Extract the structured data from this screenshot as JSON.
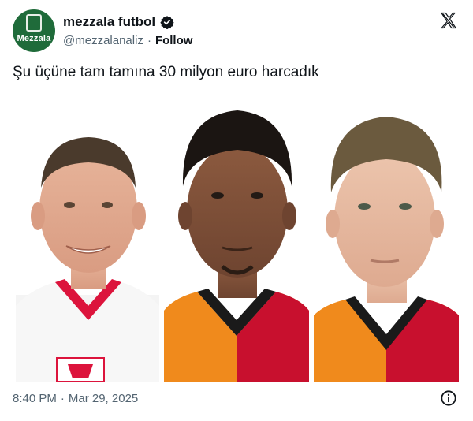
{
  "account": {
    "display_name": "mezzala futbol",
    "handle": "@mezzalanaliz",
    "separator": "·",
    "follow_label": "Follow",
    "avatar_text": "Mezzala",
    "verified": true,
    "avatar_color": "#1f6b3a"
  },
  "tweet": {
    "text": "Şu üçüne tam tamına 30 milyon euro harcadık"
  },
  "media": {
    "description_icons": [
      "player-1",
      "player-2",
      "player-3"
    ]
  },
  "footer": {
    "time": "8:40 PM",
    "dot": "·",
    "date": "Mar 29, 2025"
  },
  "icons": {
    "x_logo": "x-logo-icon",
    "info": "info-icon",
    "verified": "verified-badge-icon"
  },
  "colors": {
    "text_primary": "#0f1419",
    "text_secondary": "#536471",
    "galatasaray_orange": "#f08a1c",
    "galatasaray_red": "#c8102e",
    "poland_red": "#dc143c"
  }
}
